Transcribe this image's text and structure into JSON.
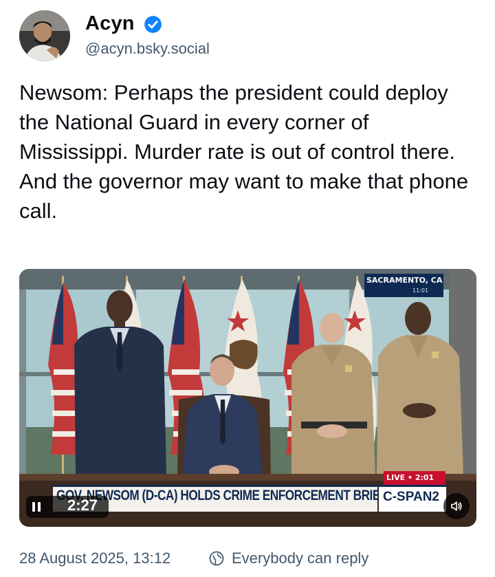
{
  "author": {
    "display_name": "Acyn",
    "handle": "@acyn.bsky.social",
    "verified": true,
    "avatar_icon": "user-avatar"
  },
  "post": {
    "text": "Newsom: Perhaps the president could deploy the National Guard in every corner of Mississippi. Murder rate is out of control there. And the governor may want to make that phone call."
  },
  "video": {
    "duration": "2:27",
    "play_state_icon": "pause-icon",
    "volume_icon": "speaker-icon",
    "location_text": "SACRAMENTO, CA",
    "location_time": "11:01",
    "live_label": "LIVE • 2:01",
    "chyron": "GOV. NEWSOM (D-CA) HOLDS CRIME ENFORCEMENT BRIEFING",
    "network": "C-SPAN2"
  },
  "footer": {
    "timestamp": "28 August 2025, 13:12",
    "reply_setting": "Everybody can reply",
    "reply_icon": "globe-reply-icon"
  },
  "colors": {
    "verified_badge": "#1083fe",
    "secondary_text": "#42576c",
    "cspan_navy": "#0f2a52",
    "live_red": "#c8102e"
  }
}
